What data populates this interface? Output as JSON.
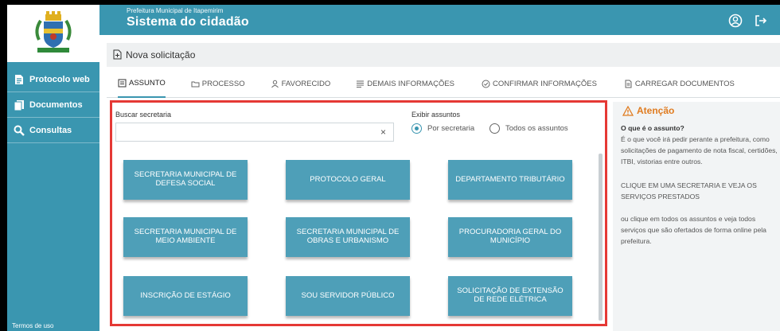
{
  "header": {
    "org_name": "Prefeitura Municipal de Itapemirim",
    "app_title": "Sistema do cidadão",
    "icons": [
      "user-icon",
      "logout-icon"
    ]
  },
  "sidebar": {
    "items": [
      {
        "label": "Protocolo web",
        "icon": "document-icon"
      },
      {
        "label": "Documentos",
        "icon": "files-icon"
      },
      {
        "label": "Consultas",
        "icon": "search-icon"
      }
    ],
    "footer": "Termos de uso"
  },
  "page": {
    "title": "Nova solicitação"
  },
  "tabs": [
    {
      "label": "ASSUNTO",
      "active": true
    },
    {
      "label": "PROCESSO",
      "active": false
    },
    {
      "label": "FAVORECIDO",
      "active": false
    },
    {
      "label": "DEMAIS INFORMAÇÕES",
      "active": false
    },
    {
      "label": "CONFIRMAR INFORMAÇÕES",
      "active": false
    },
    {
      "label": "CARREGAR DOCUMENTOS",
      "active": false
    }
  ],
  "form": {
    "search_label": "Buscar secretaria",
    "search_value": "",
    "clear_symbol": "×",
    "exibir_label": "Exibir assuntos",
    "radio_options": [
      {
        "label": "Por secretaria",
        "selected": true
      },
      {
        "label": "Todos os assuntos",
        "selected": false
      }
    ]
  },
  "cards": [
    "SECRETARIA MUNICIPAL DE DEFESA SOCIAL",
    "PROTOCOLO GERAL",
    "DEPARTAMENTO TRIBUTÁRIO",
    "SECRETARIA MUNICIPAL DE MEIO AMBIENTE",
    "SECRETARIA MUNICIPAL DE OBRAS E URBANISMO",
    "PROCURADORIA GERAL DO MUNICÍPIO",
    "INSCRIÇÃO DE ESTÁGIO",
    "SOU SERVIDOR PÚBLICO",
    "SOLICITAÇÃO DE EXTENSÃO DE REDE ELÉTRICA"
  ],
  "aside": {
    "title": "Atenção",
    "question": "O que é o assunto?",
    "p1": "É o que você irá pedir perante a prefeitura, como solicitações de pagamento de nota fiscal, certidões, ITBI, vistorias entre outros.",
    "p2": "CLIQUE EM UMA SECRETARIA E VEJA OS SERVIÇOS PRESTADOS",
    "p3": "ou clique em todos os assuntos e veja todos serviços que são ofertados de forma online pela prefeitura."
  },
  "colors": {
    "primary": "#3a96b0",
    "card": "#4e9fb8",
    "highlight_frame": "#e53935",
    "attention": "#e07b1f"
  }
}
